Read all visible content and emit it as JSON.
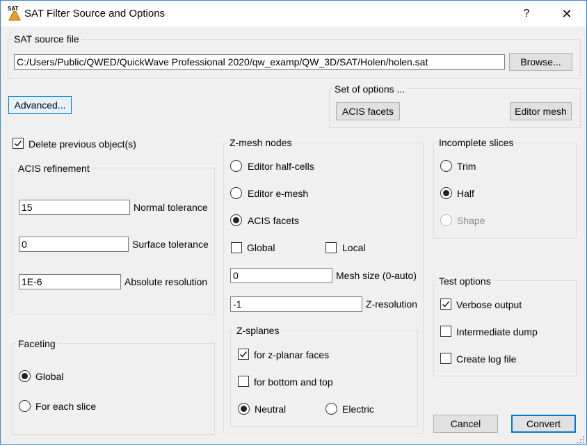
{
  "window": {
    "title": "SAT Filter Source and Options",
    "help_glyph": "?",
    "close_glyph": "✕"
  },
  "source": {
    "group_label": "SAT source file",
    "path": "C:/Users/Public/QWED/QuickWave Professional 2020/qw_examp/QW_3D/SAT/Holen/holen.sat",
    "browse_label": "Browse..."
  },
  "advanced_label": "Advanced...",
  "options_set": {
    "group_label": "Set of options ...",
    "acis_facets_label": "ACIS facets",
    "editor_mesh_label": "Editor mesh"
  },
  "delete_previous": {
    "label": "Delete previous object(s)",
    "checked": true
  },
  "acis_refinement": {
    "group_label": "ACIS refinement",
    "normal_tolerance": {
      "value": "15",
      "label": "Normal tolerance"
    },
    "surface_tolerance": {
      "value": "0",
      "label": "Surface tolerance"
    },
    "absolute_resolution": {
      "value": "1E-6",
      "label": "Absolute resolution"
    }
  },
  "faceting": {
    "group_label": "Faceting",
    "options": [
      {
        "label": "Global",
        "selected": true
      },
      {
        "label": "For each slice",
        "selected": false
      }
    ]
  },
  "zmesh": {
    "group_label": "Z-mesh nodes",
    "options": [
      {
        "label": "Editor half-cells",
        "selected": false
      },
      {
        "label": "Editor e-mesh",
        "selected": false
      },
      {
        "label": "ACIS facets",
        "selected": true
      }
    ],
    "global": {
      "label": "Global",
      "checked": false
    },
    "local": {
      "label": "Local",
      "checked": false
    },
    "mesh_size": {
      "value": "0",
      "label": "Mesh size (0-auto)"
    },
    "z_resolution": {
      "value": "-1",
      "label": "Z-resolution"
    }
  },
  "zsplanes": {
    "group_label": "Z-splanes",
    "planar_faces": {
      "label": "for z-planar faces",
      "checked": true
    },
    "bottom_top": {
      "label": "for bottom and top",
      "checked": false
    },
    "neutral": {
      "label": "Neutral",
      "selected": true
    },
    "electric": {
      "label": "Electric",
      "selected": false
    }
  },
  "incomplete_slices": {
    "group_label": "Incomplete slices",
    "options": [
      {
        "label": "Trim",
        "selected": false
      },
      {
        "label": "Half",
        "selected": true
      },
      {
        "label": "Shape",
        "selected": false
      }
    ]
  },
  "test_options": {
    "group_label": "Test options",
    "items": [
      {
        "label": "Verbose output",
        "checked": true
      },
      {
        "label": "Intermediate dump",
        "checked": false
      },
      {
        "label": "Create log file",
        "checked": false
      }
    ]
  },
  "footer": {
    "cancel_label": "Cancel",
    "convert_label": "Convert"
  }
}
